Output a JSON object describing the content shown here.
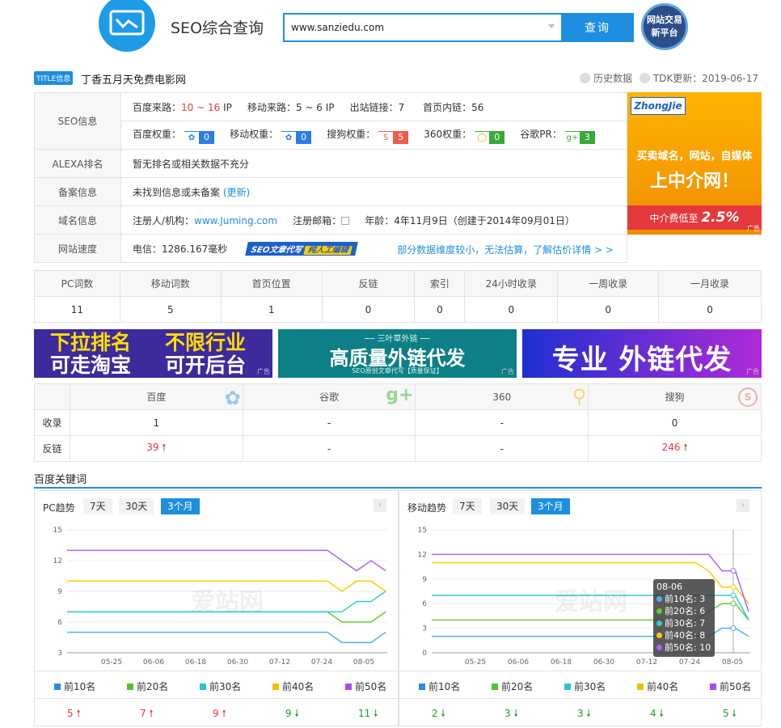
{
  "header": {
    "site_title": "SEO综合查询",
    "search_value": "www.sanziedu.com",
    "search_button": "查询",
    "trade_line1": "网站交易",
    "trade_line2": "新平台"
  },
  "title_bar": {
    "badge": "TITLE信息",
    "title": "丁香五月天免费电影网",
    "history": "历史数据",
    "tdk": "TDK更新：2019-06-17"
  },
  "seo_info": {
    "label": "SEO信息",
    "baidu_traffic_label": "百度来路：",
    "baidu_traffic": "10 ~ 16",
    "ip": "IP",
    "mobile_traffic_label": "移动来路：",
    "mobile_traffic": "5 ~ 6",
    "out_links_label": "出站链接：",
    "out_links": "7",
    "inner_links_label": "首页内链：",
    "inner_links": "56",
    "baidu_weight_label": "百度权重：",
    "baidu_weight": "0",
    "mobile_weight_label": "移动权重：",
    "mobile_weight": "0",
    "sogou_weight_label": "搜狗权重：",
    "sogou_weight": "5",
    "w360_label": "360权重：",
    "w360": "0",
    "google_label": "谷歌PR：",
    "google": "3"
  },
  "alexa": {
    "label": "ALEXA排名",
    "value": "暂无排名或相关数据不充分"
  },
  "icp": {
    "label": "备案信息",
    "value": "未找到信息或未备案",
    "update": "(更新)"
  },
  "domain": {
    "label": "域名信息",
    "registrant_label": "注册人/机构：",
    "registrant": "www.Juming.com",
    "email_label": "注册邮箱：",
    "age_label": "年龄：",
    "age": "4年11月9日",
    "created": "（创建于2014年09月01日）"
  },
  "speed": {
    "label": "网站速度",
    "value": "电信：1286.167毫秒",
    "badge1": "SEO文章代写",
    "badge2": "纯人工编辑",
    "note": "部分数据维度较小，无法估算，了解估价详情 > >"
  },
  "ad_right": {
    "brand": "ZhongJie",
    "line1": "买卖域名，网站，自媒体",
    "line2": "上中介网！",
    "line3": "中介费低至",
    "rate": "2.5%",
    "tag": "广告"
  },
  "stats": {
    "headers": [
      "PC词数",
      "移动词数",
      "首页位置",
      "反链",
      "索引",
      "24小时收录",
      "一周收录",
      "一月收录"
    ],
    "values": [
      "11",
      "5",
      "1",
      "0",
      "0",
      "0",
      "0",
      "0"
    ]
  },
  "banners": {
    "b1_l1": "下拉排名",
    "b1_l2": "可走淘宝",
    "b1_r1": "不限行业",
    "b1_r2": "可开后台",
    "b2_top": "── 三叶草外链 ──",
    "b2_main": "高质量外链代发",
    "b2_sub": "SEO原创文章代写【质量保证】",
    "b3": "专业 外链代发",
    "tag": "广告"
  },
  "engines": {
    "headers": [
      "",
      "百度",
      "谷歌",
      "360",
      "搜狗"
    ],
    "row1": [
      "收录",
      "1",
      "-",
      "-",
      "0"
    ],
    "row2": [
      "反链",
      "39",
      "-",
      "-",
      "246"
    ]
  },
  "keywords": {
    "title": "百度关键词",
    "pc_title": "PC趋势",
    "mobile_title": "移动趋势",
    "tabs": [
      "7天",
      "30天",
      "3个月"
    ],
    "watermark": "爱站网"
  },
  "chart_data": [
    {
      "type": "line",
      "title": "PC趋势",
      "x": [
        "05-25",
        "06-06",
        "06-18",
        "06-30",
        "07-12",
        "07-24",
        "08-05"
      ],
      "ylim": [
        3,
        15
      ],
      "yticks": [
        3,
        6,
        9,
        12,
        15
      ],
      "series": [
        {
          "name": "前10名",
          "color": "#4fb0f0",
          "values": [
            5,
            5,
            5,
            5,
            5,
            5,
            5,
            4,
            4,
            4,
            5
          ]
        },
        {
          "name": "前20名",
          "color": "#66cc33",
          "values": [
            7,
            7,
            7,
            7,
            7,
            7,
            7,
            6,
            6,
            6,
            7
          ]
        },
        {
          "name": "前30名",
          "color": "#33cccc",
          "values": [
            7,
            7,
            7,
            7,
            7,
            7,
            7,
            7,
            8,
            8,
            9
          ]
        },
        {
          "name": "前40名",
          "color": "#ffcc00",
          "values": [
            10,
            10,
            10,
            10,
            10,
            10,
            10,
            9,
            10,
            10,
            9
          ]
        },
        {
          "name": "前50名",
          "color": "#aa66ee",
          "values": [
            13,
            13,
            13,
            13,
            13,
            13,
            13,
            12,
            11,
            12,
            11
          ]
        }
      ]
    },
    {
      "type": "line",
      "title": "移动趋势",
      "x": [
        "05-25",
        "06-06",
        "06-18",
        "06-30",
        "07-12",
        "07-24",
        "08-05"
      ],
      "ylim": [
        0,
        15
      ],
      "yticks": [
        0,
        3,
        6,
        9,
        12,
        15
      ],
      "series": [
        {
          "name": "前10名",
          "color": "#4fb0f0",
          "values": [
            2,
            2,
            2,
            2,
            2,
            2,
            2,
            2,
            3,
            3,
            2
          ]
        },
        {
          "name": "前20名",
          "color": "#66cc33",
          "values": [
            4,
            4,
            4,
            4,
            4,
            4,
            4,
            5,
            6,
            6,
            4
          ]
        },
        {
          "name": "前30名",
          "color": "#33cccc",
          "values": [
            7,
            7,
            7,
            7,
            7,
            7,
            7,
            7,
            7,
            7,
            4
          ]
        },
        {
          "name": "前40名",
          "color": "#ffcc00",
          "values": [
            11,
            11,
            11,
            11,
            11,
            11,
            11,
            10,
            8,
            8,
            6
          ]
        },
        {
          "name": "前50名",
          "color": "#aa66ee",
          "values": [
            12,
            12,
            12,
            12,
            12,
            12,
            12,
            12,
            10,
            10,
            5
          ]
        }
      ]
    }
  ],
  "tooltip": {
    "date": "08-06",
    "lines": [
      "前10名: 3",
      "前20名: 6",
      "前30名: 7",
      "前40名: 8",
      "前50名: 10"
    ]
  },
  "legend": [
    "前10名",
    "前20名",
    "前30名",
    "前40名",
    "前50名"
  ],
  "pc_counts": [
    "5",
    "7",
    "9",
    "9",
    "11"
  ],
  "mobile_counts": [
    "2",
    "3",
    "3",
    "4",
    "5"
  ]
}
